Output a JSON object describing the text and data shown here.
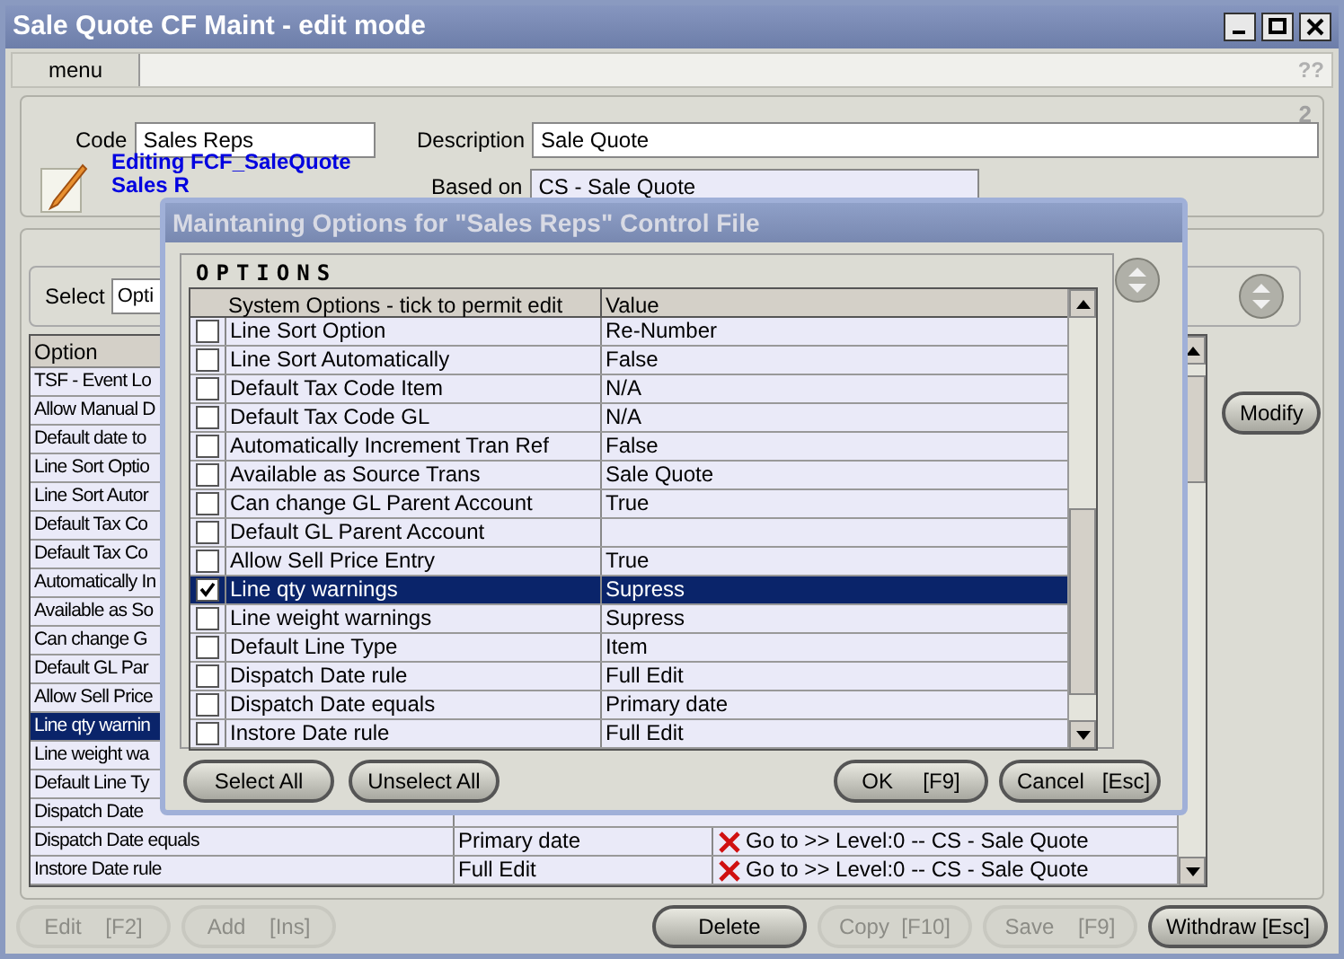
{
  "window": {
    "title": "Sale Quote CF Maint - edit mode"
  },
  "menu": {
    "label": "menu",
    "help": "??"
  },
  "header": {
    "page": "2",
    "code_label": "Code",
    "code": "Sales Reps",
    "description_label": "Description",
    "description": "Sale Quote",
    "based_on_label": "Based on",
    "based_on": "CS - Sale Quote",
    "editing": "Editing FCF_SaleQuote",
    "editing_sub": "Sales R"
  },
  "select": {
    "label": "Select",
    "value": "Opti"
  },
  "table": {
    "columns": [
      "Option"
    ],
    "rows": [
      {
        "option": "TSF - Event Lo",
        "selected": false
      },
      {
        "option": "Allow Manual D",
        "selected": false
      },
      {
        "option": "Default date to",
        "selected": false
      },
      {
        "option": "Line Sort Optio",
        "selected": false
      },
      {
        "option": "Line Sort Autor",
        "selected": false
      },
      {
        "option": "Default Tax Co",
        "selected": false
      },
      {
        "option": "Default Tax Co",
        "selected": false
      },
      {
        "option": "Automatically In",
        "selected": false
      },
      {
        "option": "Available as So",
        "selected": false
      },
      {
        "option": "Can change G",
        "selected": false
      },
      {
        "option": "Default GL Par",
        "selected": false
      },
      {
        "option": "Allow Sell Price",
        "selected": false
      },
      {
        "option": "Line qty warnin",
        "selected": true
      },
      {
        "option": "Line weight wa",
        "selected": false
      },
      {
        "option": "Default Line Ty",
        "selected": false
      },
      {
        "option": "Dispatch Date",
        "selected": false
      },
      {
        "option": "Dispatch Date equals",
        "value": "Primary date",
        "link": "Go to >> Level:0 -- CS - Sale Quote",
        "selected": false
      },
      {
        "option": "Instore Date rule",
        "value": "Full Edit",
        "link": "Go to >> Level:0 -- CS - Sale Quote",
        "selected": false
      }
    ]
  },
  "modify_button": "Modify",
  "buttons": [
    {
      "label": "Edit    [F2]",
      "disabled": true
    },
    {
      "label": "Add    [Ins]",
      "disabled": true
    },
    {
      "label": "Delete",
      "disabled": false
    },
    {
      "label": "Copy  [F10]",
      "disabled": true
    },
    {
      "label": "Save    [F9]",
      "disabled": true
    },
    {
      "label": "Withdraw [Esc]",
      "disabled": false
    }
  ],
  "dialog": {
    "title": "Maintaning Options for \"Sales Reps\" Control File",
    "section": "OPTIONS",
    "columns": [
      "System Options - tick to permit edit",
      "Value"
    ],
    "rows": [
      {
        "option": "Line Sort Option",
        "value": "Re-Number",
        "checked": false,
        "selected": false
      },
      {
        "option": "Line Sort Automatically",
        "value": "False",
        "checked": false,
        "selected": false
      },
      {
        "option": "Default Tax Code Item",
        "value": "N/A",
        "checked": false,
        "selected": false
      },
      {
        "option": "Default Tax Code GL",
        "value": "N/A",
        "checked": false,
        "selected": false
      },
      {
        "option": "Automatically Increment Tran Ref",
        "value": "False",
        "checked": false,
        "selected": false
      },
      {
        "option": "Available as Source Trans",
        "value": "Sale Quote",
        "checked": false,
        "selected": false
      },
      {
        "option": "Can change GL Parent Account",
        "value": "True",
        "checked": false,
        "selected": false
      },
      {
        "option": "Default GL Parent Account",
        "checked": false,
        "selected": false
      },
      {
        "option": "Allow Sell Price Entry",
        "value": "True",
        "checked": false,
        "selected": false
      },
      {
        "option": "Line qty warnings",
        "value": "Supress",
        "checked": true,
        "selected": true
      },
      {
        "option": "Line weight warnings",
        "value": "Supress",
        "checked": false,
        "selected": false
      },
      {
        "option": "Default Line Type",
        "value": "Item",
        "checked": false,
        "selected": false
      },
      {
        "option": "Dispatch Date rule",
        "value": "Full Edit",
        "checked": false,
        "selected": false
      },
      {
        "option": "Dispatch Date equals",
        "value": "Primary date",
        "checked": false,
        "selected": false
      },
      {
        "option": "Instore Date rule",
        "value": "Full Edit",
        "checked": false,
        "selected": false
      }
    ],
    "buttons": [
      "Select All",
      "Unselect All"
    ],
    "ok": "OK     [F9]",
    "cancel": "Cancel   [Esc]"
  }
}
